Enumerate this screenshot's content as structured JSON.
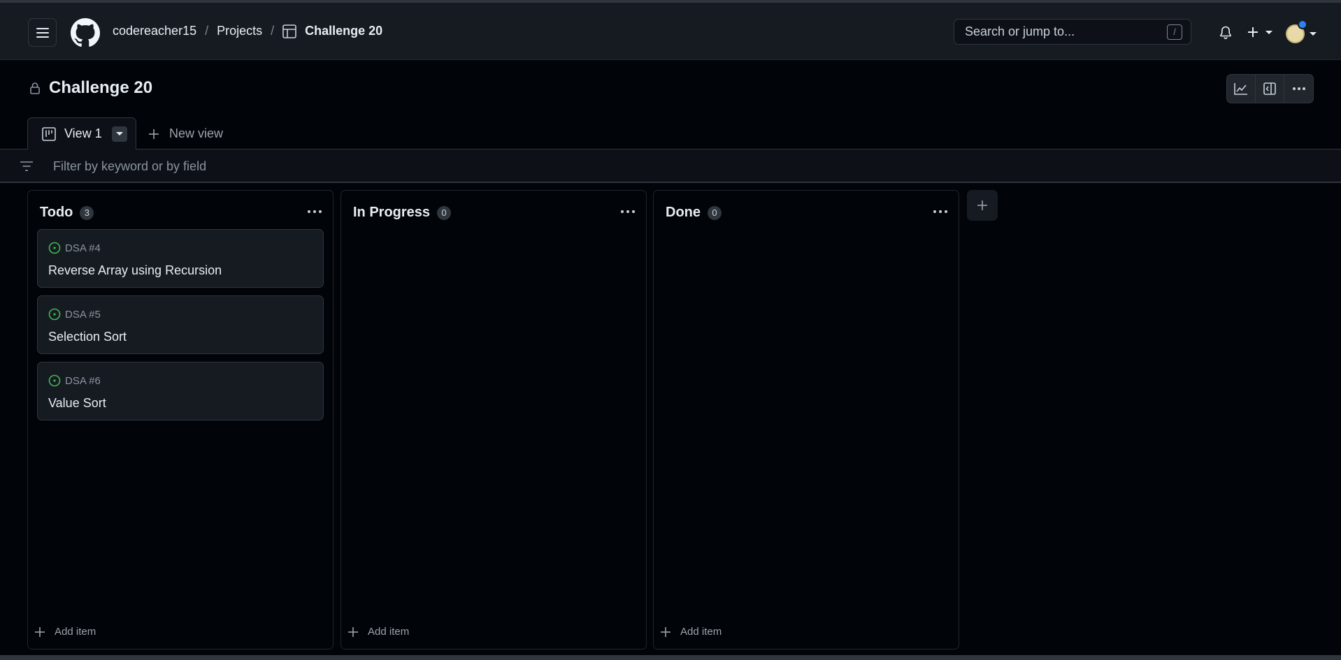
{
  "header": {
    "breadcrumbs": {
      "owner": "codereacher15",
      "projects": "Projects",
      "current": "Challenge 20",
      "separator": "/"
    },
    "search": {
      "placeholder": "Search or jump to...",
      "shortcut": "/"
    },
    "icons": [
      "menu-icon",
      "github-logo-icon",
      "table-icon",
      "bell-icon",
      "plus-icon",
      "avatar"
    ]
  },
  "project": {
    "title": "Challenge 20",
    "visibility_icon": "lock-icon",
    "actions": [
      "insights-icon",
      "side-panel-icon",
      "kebab-menu-icon"
    ]
  },
  "views": {
    "tabs": [
      {
        "label": "View 1",
        "icon": "board-icon",
        "active": true
      }
    ],
    "new_view_label": "New view"
  },
  "filter": {
    "placeholder": "Filter by keyword or by field"
  },
  "board": {
    "columns": [
      {
        "title": "Todo",
        "count": "3",
        "cards": [
          {
            "ref": "DSA #4",
            "title": "Reverse Array using Recursion",
            "status_icon": "issue-open-icon"
          },
          {
            "ref": "DSA #5",
            "title": "Selection Sort",
            "status_icon": "issue-open-icon"
          },
          {
            "ref": "DSA #6",
            "title": "Value Sort",
            "status_icon": "issue-open-icon"
          }
        ],
        "add_item_label": "Add item"
      },
      {
        "title": "In Progress",
        "count": "0",
        "cards": [],
        "add_item_label": "Add item"
      },
      {
        "title": "Done",
        "count": "0",
        "cards": [],
        "add_item_label": "Add item"
      }
    ]
  },
  "colors": {
    "background": "#010409",
    "header": "#161b22",
    "border": "#30363d",
    "open_issue": "#3fb950",
    "notification_dot": "#2f81f7"
  }
}
